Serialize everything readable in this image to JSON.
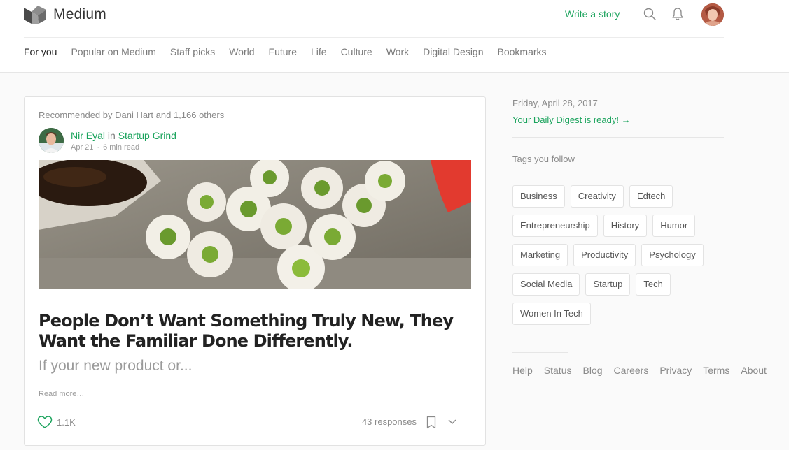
{
  "header": {
    "brand": "Medium",
    "write_story": "Write a story",
    "icons": {
      "search": "search-icon",
      "notifications": "bell-icon",
      "profile": "avatar"
    }
  },
  "nav": {
    "items": [
      {
        "label": "For you",
        "active": true
      },
      {
        "label": "Popular on Medium"
      },
      {
        "label": "Staff picks"
      },
      {
        "label": "World"
      },
      {
        "label": "Future"
      },
      {
        "label": "Life"
      },
      {
        "label": "Culture"
      },
      {
        "label": "Work"
      },
      {
        "label": "Digital Design"
      },
      {
        "label": "Bookmarks"
      }
    ]
  },
  "article": {
    "recommended": "Recommended by Dani Hart and 1,166 others",
    "author": "Nir Eyal",
    "in_word": "in",
    "publication": "Startup Grind",
    "date": "Apr 21",
    "read_time": "6 min read",
    "title": "People Don’t Want Something Truly New, They Want the Familiar Done Differently.",
    "subtitle": "If your new product or...",
    "read_more": "Read more…",
    "likes": "1.1K",
    "responses": "43 responses"
  },
  "sidebar": {
    "date": "Friday, April 28, 2017",
    "digest": "Your Daily Digest is ready! →",
    "tags_heading": "Tags you follow",
    "tags": [
      "Business",
      "Creativity",
      "Edtech",
      "Entrepreneurship",
      "History",
      "Humor",
      "Marketing",
      "Productivity",
      "Psychology",
      "Social Media",
      "Startup",
      "Tech",
      "Women In Tech"
    ],
    "footer": [
      "Help",
      "Status",
      "Blog",
      "Careers",
      "Privacy",
      "Terms",
      "About"
    ]
  },
  "colors": {
    "accent": "#1aa35c",
    "text_dark": "#222222",
    "text_muted": "#8a8a8a",
    "border": "#e2e2e2"
  }
}
